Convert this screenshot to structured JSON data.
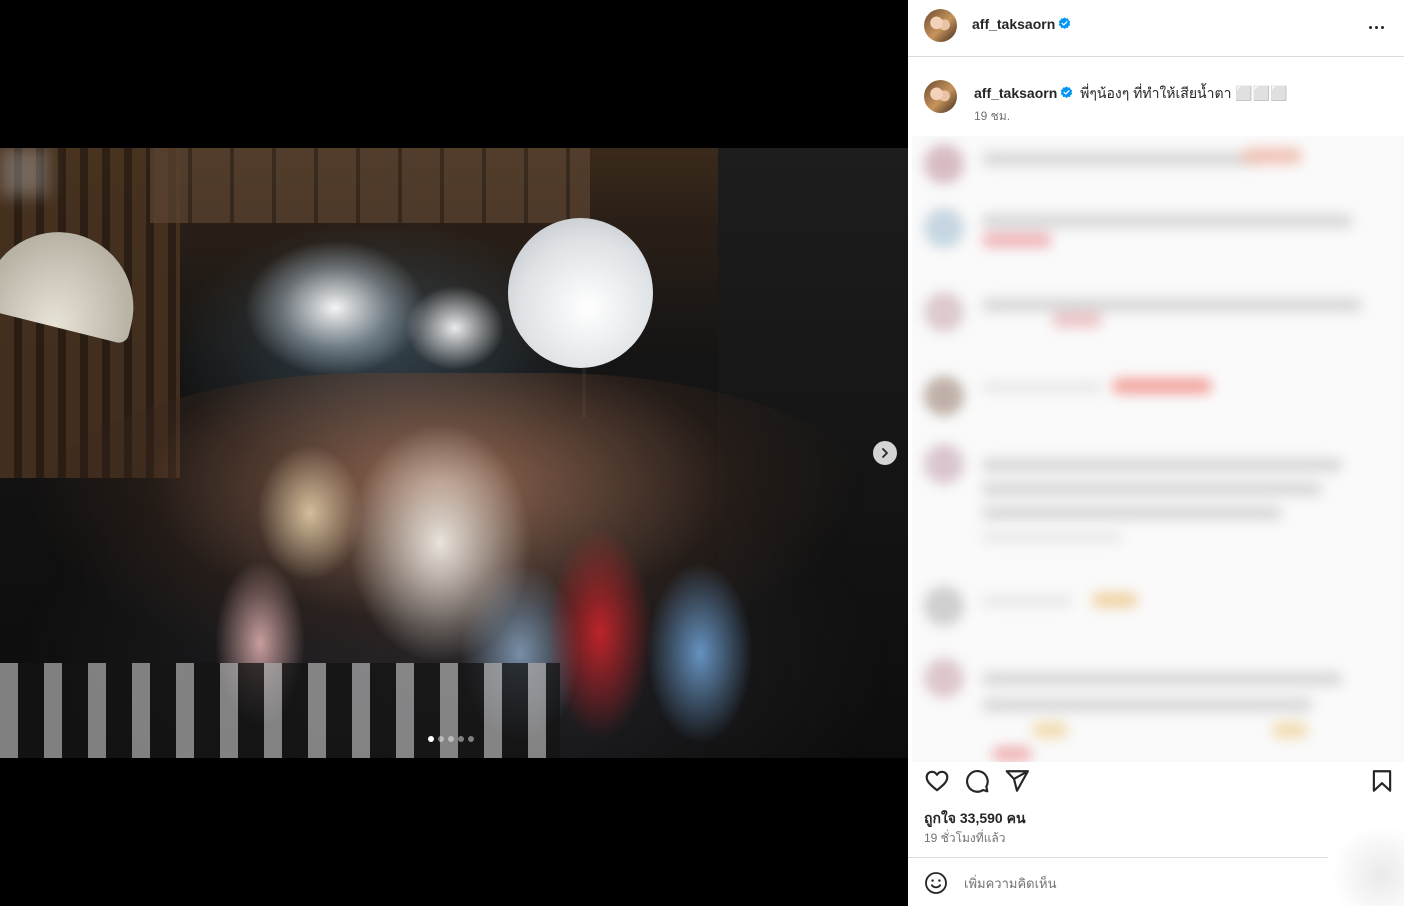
{
  "post": {
    "username": "aff_taksaorn",
    "verified": true,
    "caption_text": "พี่ๆน้องๆ ที่ทำให้เสียน้ำตา ⬜⬜⬜",
    "caption_time": "19 ชม.",
    "likes_text": "ถูกใจ 33,590 คน",
    "posted_ago": "19 ชั่วโมงที่แล้ว"
  },
  "carousel": {
    "total_slides": 5,
    "active_slide": 1
  },
  "comment_input": {
    "placeholder": "เพิ่มความคิดเห็น"
  },
  "icons": {
    "verified": "verified-badge-icon",
    "more": "more-options-icon",
    "next": "chevron-right-icon",
    "like": "heart-icon",
    "comment": "comment-bubble-icon",
    "share": "paper-plane-icon",
    "save": "bookmark-icon",
    "emoji": "emoji-smile-icon"
  },
  "colors": {
    "verified_blue": "#0095f6",
    "text_primary": "#262626",
    "text_secondary": "#737373",
    "divider": "#dbdbdb"
  }
}
